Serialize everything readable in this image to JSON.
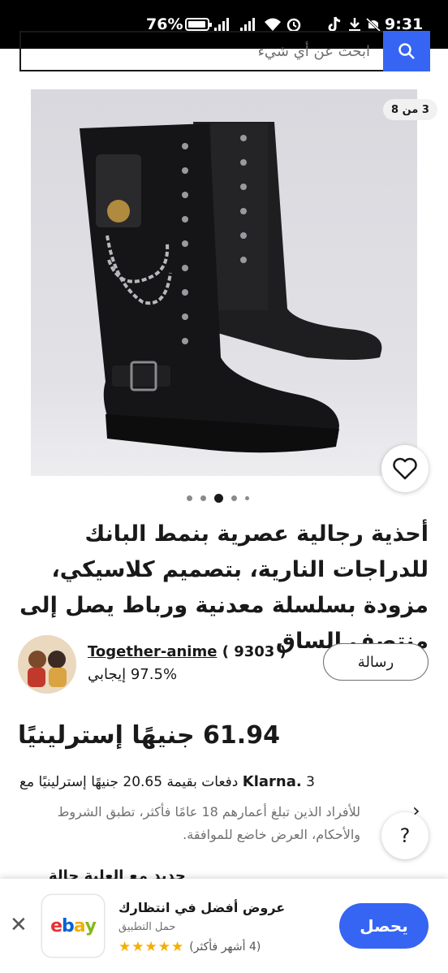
{
  "status_bar": {
    "battery": "76%",
    "time": "9:31"
  },
  "search": {
    "placeholder": "ابحث عن أي شيء"
  },
  "gallery": {
    "counter": "3 من 8",
    "dot_count": 5,
    "active_dot": 2
  },
  "product": {
    "title": "أحذية رجالية عصرية بنمط البانك للدراجات النارية، بتصميم كلاسيكي، مزودة بسلسلة معدنية ورباط يصل إلى منتصف الساق",
    "price": "61.94 جنيهًا إسترلينيًا"
  },
  "seller": {
    "name": "Together-anime",
    "count": "( 9303 )",
    "feedback": "97.5% إيجابي",
    "message_label": "رسالة"
  },
  "klarna": {
    "brand": "Klarna.",
    "text": "3 دفعات بقيمة 20.65 جنيهًا إسترلينيًا مع",
    "note": "للأفراد الذين تبلغ أعمارهم 18 عامًا فأكثر، تطبق الشروط والأحكام، العرض خاضع للموافقة."
  },
  "peek_text": "جديد مع العلبة حالة",
  "app_banner": {
    "title": "عروض أفضل في انتظارك",
    "subtitle": "حمل التطبيق",
    "rating_text": "(4 أشهر فأكثر)",
    "stars": "★★★★★",
    "get_label": "يحصل",
    "logo": [
      "e",
      "b",
      "a",
      "y"
    ]
  },
  "colors": {
    "accent": "#3665f3",
    "text": "#191919",
    "muted": "#707070"
  }
}
